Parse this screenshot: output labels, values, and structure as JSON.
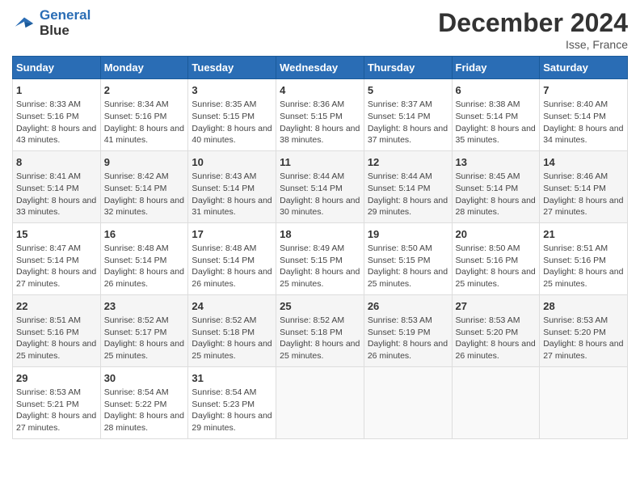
{
  "logo": {
    "line1": "General",
    "line2": "Blue"
  },
  "title": "December 2024",
  "location": "Isse, France",
  "days_header": [
    "Sunday",
    "Monday",
    "Tuesday",
    "Wednesday",
    "Thursday",
    "Friday",
    "Saturday"
  ],
  "weeks": [
    [
      {
        "day": "1",
        "sunrise": "Sunrise: 8:33 AM",
        "sunset": "Sunset: 5:16 PM",
        "daylight": "Daylight: 8 hours and 43 minutes."
      },
      {
        "day": "2",
        "sunrise": "Sunrise: 8:34 AM",
        "sunset": "Sunset: 5:16 PM",
        "daylight": "Daylight: 8 hours and 41 minutes."
      },
      {
        "day": "3",
        "sunrise": "Sunrise: 8:35 AM",
        "sunset": "Sunset: 5:15 PM",
        "daylight": "Daylight: 8 hours and 40 minutes."
      },
      {
        "day": "4",
        "sunrise": "Sunrise: 8:36 AM",
        "sunset": "Sunset: 5:15 PM",
        "daylight": "Daylight: 8 hours and 38 minutes."
      },
      {
        "day": "5",
        "sunrise": "Sunrise: 8:37 AM",
        "sunset": "Sunset: 5:14 PM",
        "daylight": "Daylight: 8 hours and 37 minutes."
      },
      {
        "day": "6",
        "sunrise": "Sunrise: 8:38 AM",
        "sunset": "Sunset: 5:14 PM",
        "daylight": "Daylight: 8 hours and 35 minutes."
      },
      {
        "day": "7",
        "sunrise": "Sunrise: 8:40 AM",
        "sunset": "Sunset: 5:14 PM",
        "daylight": "Daylight: 8 hours and 34 minutes."
      }
    ],
    [
      {
        "day": "8",
        "sunrise": "Sunrise: 8:41 AM",
        "sunset": "Sunset: 5:14 PM",
        "daylight": "Daylight: 8 hours and 33 minutes."
      },
      {
        "day": "9",
        "sunrise": "Sunrise: 8:42 AM",
        "sunset": "Sunset: 5:14 PM",
        "daylight": "Daylight: 8 hours and 32 minutes."
      },
      {
        "day": "10",
        "sunrise": "Sunrise: 8:43 AM",
        "sunset": "Sunset: 5:14 PM",
        "daylight": "Daylight: 8 hours and 31 minutes."
      },
      {
        "day": "11",
        "sunrise": "Sunrise: 8:44 AM",
        "sunset": "Sunset: 5:14 PM",
        "daylight": "Daylight: 8 hours and 30 minutes."
      },
      {
        "day": "12",
        "sunrise": "Sunrise: 8:44 AM",
        "sunset": "Sunset: 5:14 PM",
        "daylight": "Daylight: 8 hours and 29 minutes."
      },
      {
        "day": "13",
        "sunrise": "Sunrise: 8:45 AM",
        "sunset": "Sunset: 5:14 PM",
        "daylight": "Daylight: 8 hours and 28 minutes."
      },
      {
        "day": "14",
        "sunrise": "Sunrise: 8:46 AM",
        "sunset": "Sunset: 5:14 PM",
        "daylight": "Daylight: 8 hours and 27 minutes."
      }
    ],
    [
      {
        "day": "15",
        "sunrise": "Sunrise: 8:47 AM",
        "sunset": "Sunset: 5:14 PM",
        "daylight": "Daylight: 8 hours and 27 minutes."
      },
      {
        "day": "16",
        "sunrise": "Sunrise: 8:48 AM",
        "sunset": "Sunset: 5:14 PM",
        "daylight": "Daylight: 8 hours and 26 minutes."
      },
      {
        "day": "17",
        "sunrise": "Sunrise: 8:48 AM",
        "sunset": "Sunset: 5:14 PM",
        "daylight": "Daylight: 8 hours and 26 minutes."
      },
      {
        "day": "18",
        "sunrise": "Sunrise: 8:49 AM",
        "sunset": "Sunset: 5:15 PM",
        "daylight": "Daylight: 8 hours and 25 minutes."
      },
      {
        "day": "19",
        "sunrise": "Sunrise: 8:50 AM",
        "sunset": "Sunset: 5:15 PM",
        "daylight": "Daylight: 8 hours and 25 minutes."
      },
      {
        "day": "20",
        "sunrise": "Sunrise: 8:50 AM",
        "sunset": "Sunset: 5:16 PM",
        "daylight": "Daylight: 8 hours and 25 minutes."
      },
      {
        "day": "21",
        "sunrise": "Sunrise: 8:51 AM",
        "sunset": "Sunset: 5:16 PM",
        "daylight": "Daylight: 8 hours and 25 minutes."
      }
    ],
    [
      {
        "day": "22",
        "sunrise": "Sunrise: 8:51 AM",
        "sunset": "Sunset: 5:16 PM",
        "daylight": "Daylight: 8 hours and 25 minutes."
      },
      {
        "day": "23",
        "sunrise": "Sunrise: 8:52 AM",
        "sunset": "Sunset: 5:17 PM",
        "daylight": "Daylight: 8 hours and 25 minutes."
      },
      {
        "day": "24",
        "sunrise": "Sunrise: 8:52 AM",
        "sunset": "Sunset: 5:18 PM",
        "daylight": "Daylight: 8 hours and 25 minutes."
      },
      {
        "day": "25",
        "sunrise": "Sunrise: 8:52 AM",
        "sunset": "Sunset: 5:18 PM",
        "daylight": "Daylight: 8 hours and 25 minutes."
      },
      {
        "day": "26",
        "sunrise": "Sunrise: 8:53 AM",
        "sunset": "Sunset: 5:19 PM",
        "daylight": "Daylight: 8 hours and 26 minutes."
      },
      {
        "day": "27",
        "sunrise": "Sunrise: 8:53 AM",
        "sunset": "Sunset: 5:20 PM",
        "daylight": "Daylight: 8 hours and 26 minutes."
      },
      {
        "day": "28",
        "sunrise": "Sunrise: 8:53 AM",
        "sunset": "Sunset: 5:20 PM",
        "daylight": "Daylight: 8 hours and 27 minutes."
      }
    ],
    [
      {
        "day": "29",
        "sunrise": "Sunrise: 8:53 AM",
        "sunset": "Sunset: 5:21 PM",
        "daylight": "Daylight: 8 hours and 27 minutes."
      },
      {
        "day": "30",
        "sunrise": "Sunrise: 8:54 AM",
        "sunset": "Sunset: 5:22 PM",
        "daylight": "Daylight: 8 hours and 28 minutes."
      },
      {
        "day": "31",
        "sunrise": "Sunrise: 8:54 AM",
        "sunset": "Sunset: 5:23 PM",
        "daylight": "Daylight: 8 hours and 29 minutes."
      },
      null,
      null,
      null,
      null
    ]
  ]
}
